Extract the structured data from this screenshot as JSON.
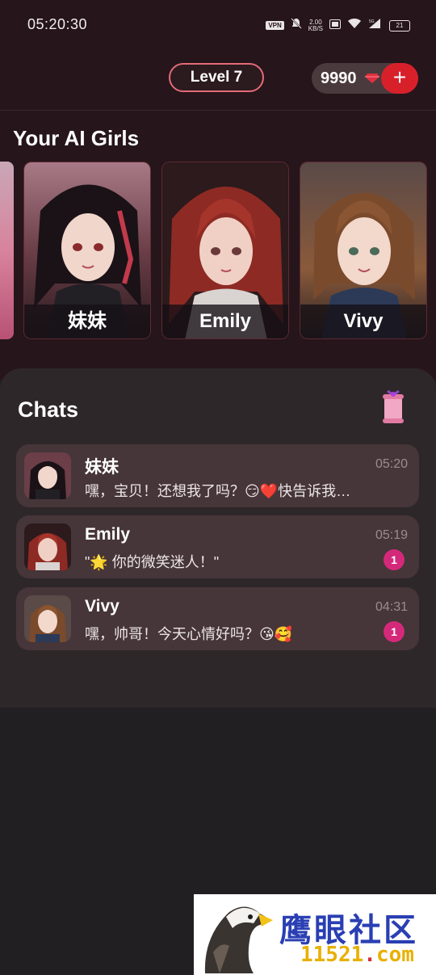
{
  "status_bar": {
    "time": "05:20:30",
    "vpn": "VPN",
    "net_speed_value": "2.00",
    "net_speed_unit": "KB/S",
    "network": "5G",
    "battery": "21"
  },
  "header": {
    "level": "Level 7",
    "coins": "9990",
    "gem_icon": "gem-icon",
    "add_icon": "+"
  },
  "ai_girls": {
    "title": "Your AI Girls",
    "cards": [
      {
        "name": "妹妹",
        "hair": "#1c1418",
        "accent": "#c23a4c",
        "bg": "#7d4b55"
      },
      {
        "name": "Emily",
        "hair": "#8e2a24",
        "accent": "#c85a4a",
        "bg": "#2c1a1c"
      },
      {
        "name": "Vivy",
        "hair": "#7a4a2c",
        "accent": "#a9713f",
        "bg": "#3d2e2a"
      }
    ]
  },
  "chats": {
    "title": "Chats",
    "items": [
      {
        "name": "妹妹",
        "time": "05:20",
        "preview": "嘿，宝贝！还想我了吗？😏❤️快告诉我你在干嘛",
        "unread": ""
      },
      {
        "name": "Emily",
        "time": "05:19",
        "preview": "\"🌟 你的微笑迷人！\"",
        "unread": "1"
      },
      {
        "name": "Vivy",
        "time": "04:31",
        "preview": "嘿，帅哥！今天心情好吗？😘🥰",
        "unread": "1"
      }
    ]
  },
  "watermark": {
    "title": "鹰眼社区",
    "domain_num": "11521",
    "domain_dot": ".",
    "domain_tld": "com"
  },
  "colors": {
    "accent_red": "#d8202b",
    "badge_pink": "#d4297a",
    "level_border": "#e36b79"
  }
}
